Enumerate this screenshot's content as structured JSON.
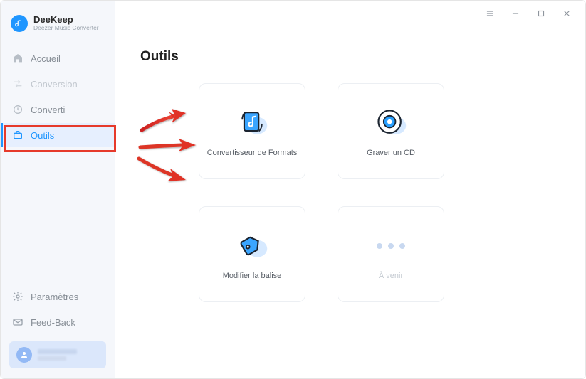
{
  "brand": {
    "title": "DeeKeep",
    "subtitle": "Deezer Music Converter"
  },
  "sidebar": {
    "items": [
      {
        "label": "Accueil"
      },
      {
        "label": "Conversion"
      },
      {
        "label": "Converti"
      },
      {
        "label": "Outils"
      }
    ],
    "bottom": [
      {
        "label": "Paramètres"
      },
      {
        "label": "Feed-Back"
      }
    ]
  },
  "main": {
    "title": "Outils",
    "tools": [
      {
        "label": "Convertisseur de Formats"
      },
      {
        "label": "Graver un CD"
      },
      {
        "label": "Modifier la balise"
      },
      {
        "label": "À venir"
      }
    ]
  },
  "colors": {
    "accent": "#1f96ff",
    "annotation": "#e63a2b"
  }
}
